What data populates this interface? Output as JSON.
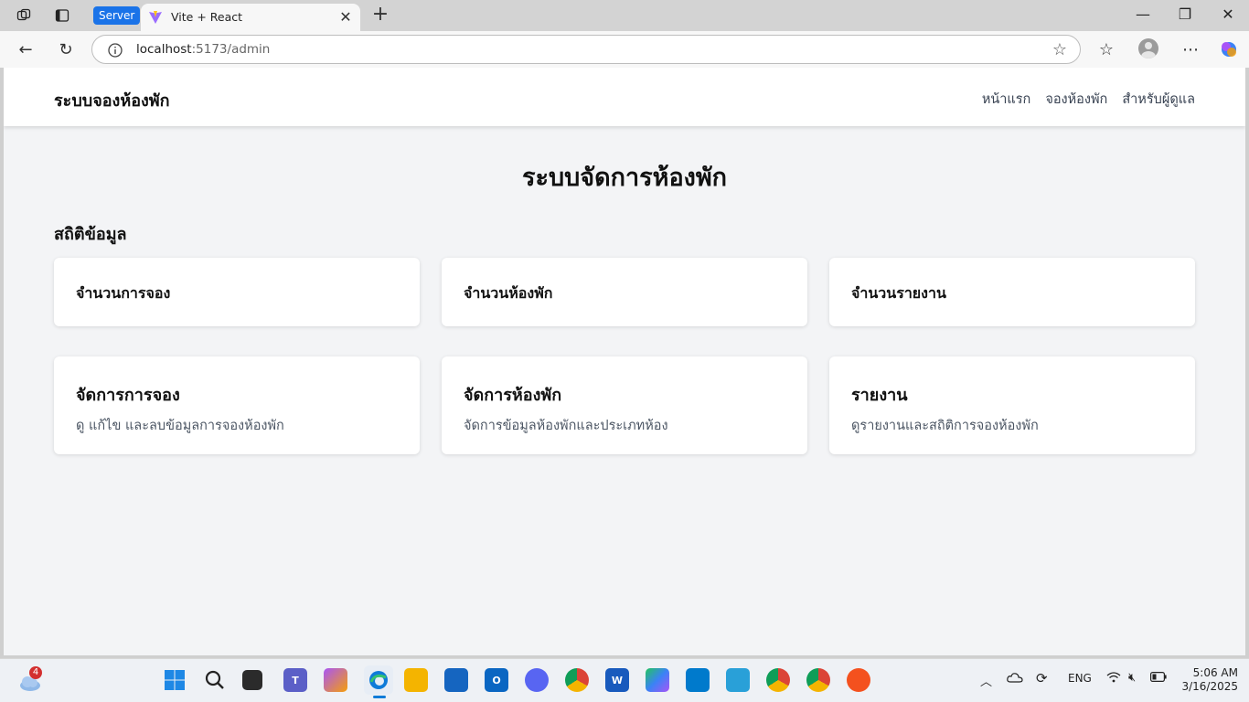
{
  "browser": {
    "server_label": "Server",
    "tab_title": "Vite + React",
    "url_host": "localhost",
    "url_rest": ":5173/admin"
  },
  "navbar": {
    "brand": "ระบบจองห้องพัก",
    "links": [
      "หน้าแรก",
      "จองห้องพัก",
      "สำหรับผู้ดูแล"
    ]
  },
  "main": {
    "title": "ระบบจัดการห้องพัก",
    "stats_title": "สถิติข้อมูล",
    "stats": [
      {
        "label": "จำนวนการจอง"
      },
      {
        "label": "จำนวนห้องพัก"
      },
      {
        "label": "จำนวนรายงาน"
      }
    ],
    "management": [
      {
        "title": "จัดการการจอง",
        "desc": "ดู แก้ไข และลบข้อมูลการจองห้องพัก"
      },
      {
        "title": "จัดการห้องพัก",
        "desc": "จัดการข้อมูลห้องพักและประเภทห้อง"
      },
      {
        "title": "รายงาน",
        "desc": "ดูรายงานและสถิติการจองห้องพัก"
      }
    ]
  },
  "taskbar": {
    "weather_badge": "4",
    "language": "ENG",
    "time": "5:06 AM",
    "date": "3/16/2025",
    "colors": {
      "accent": "#1a73e8",
      "edge": "#0f7bd8"
    }
  }
}
